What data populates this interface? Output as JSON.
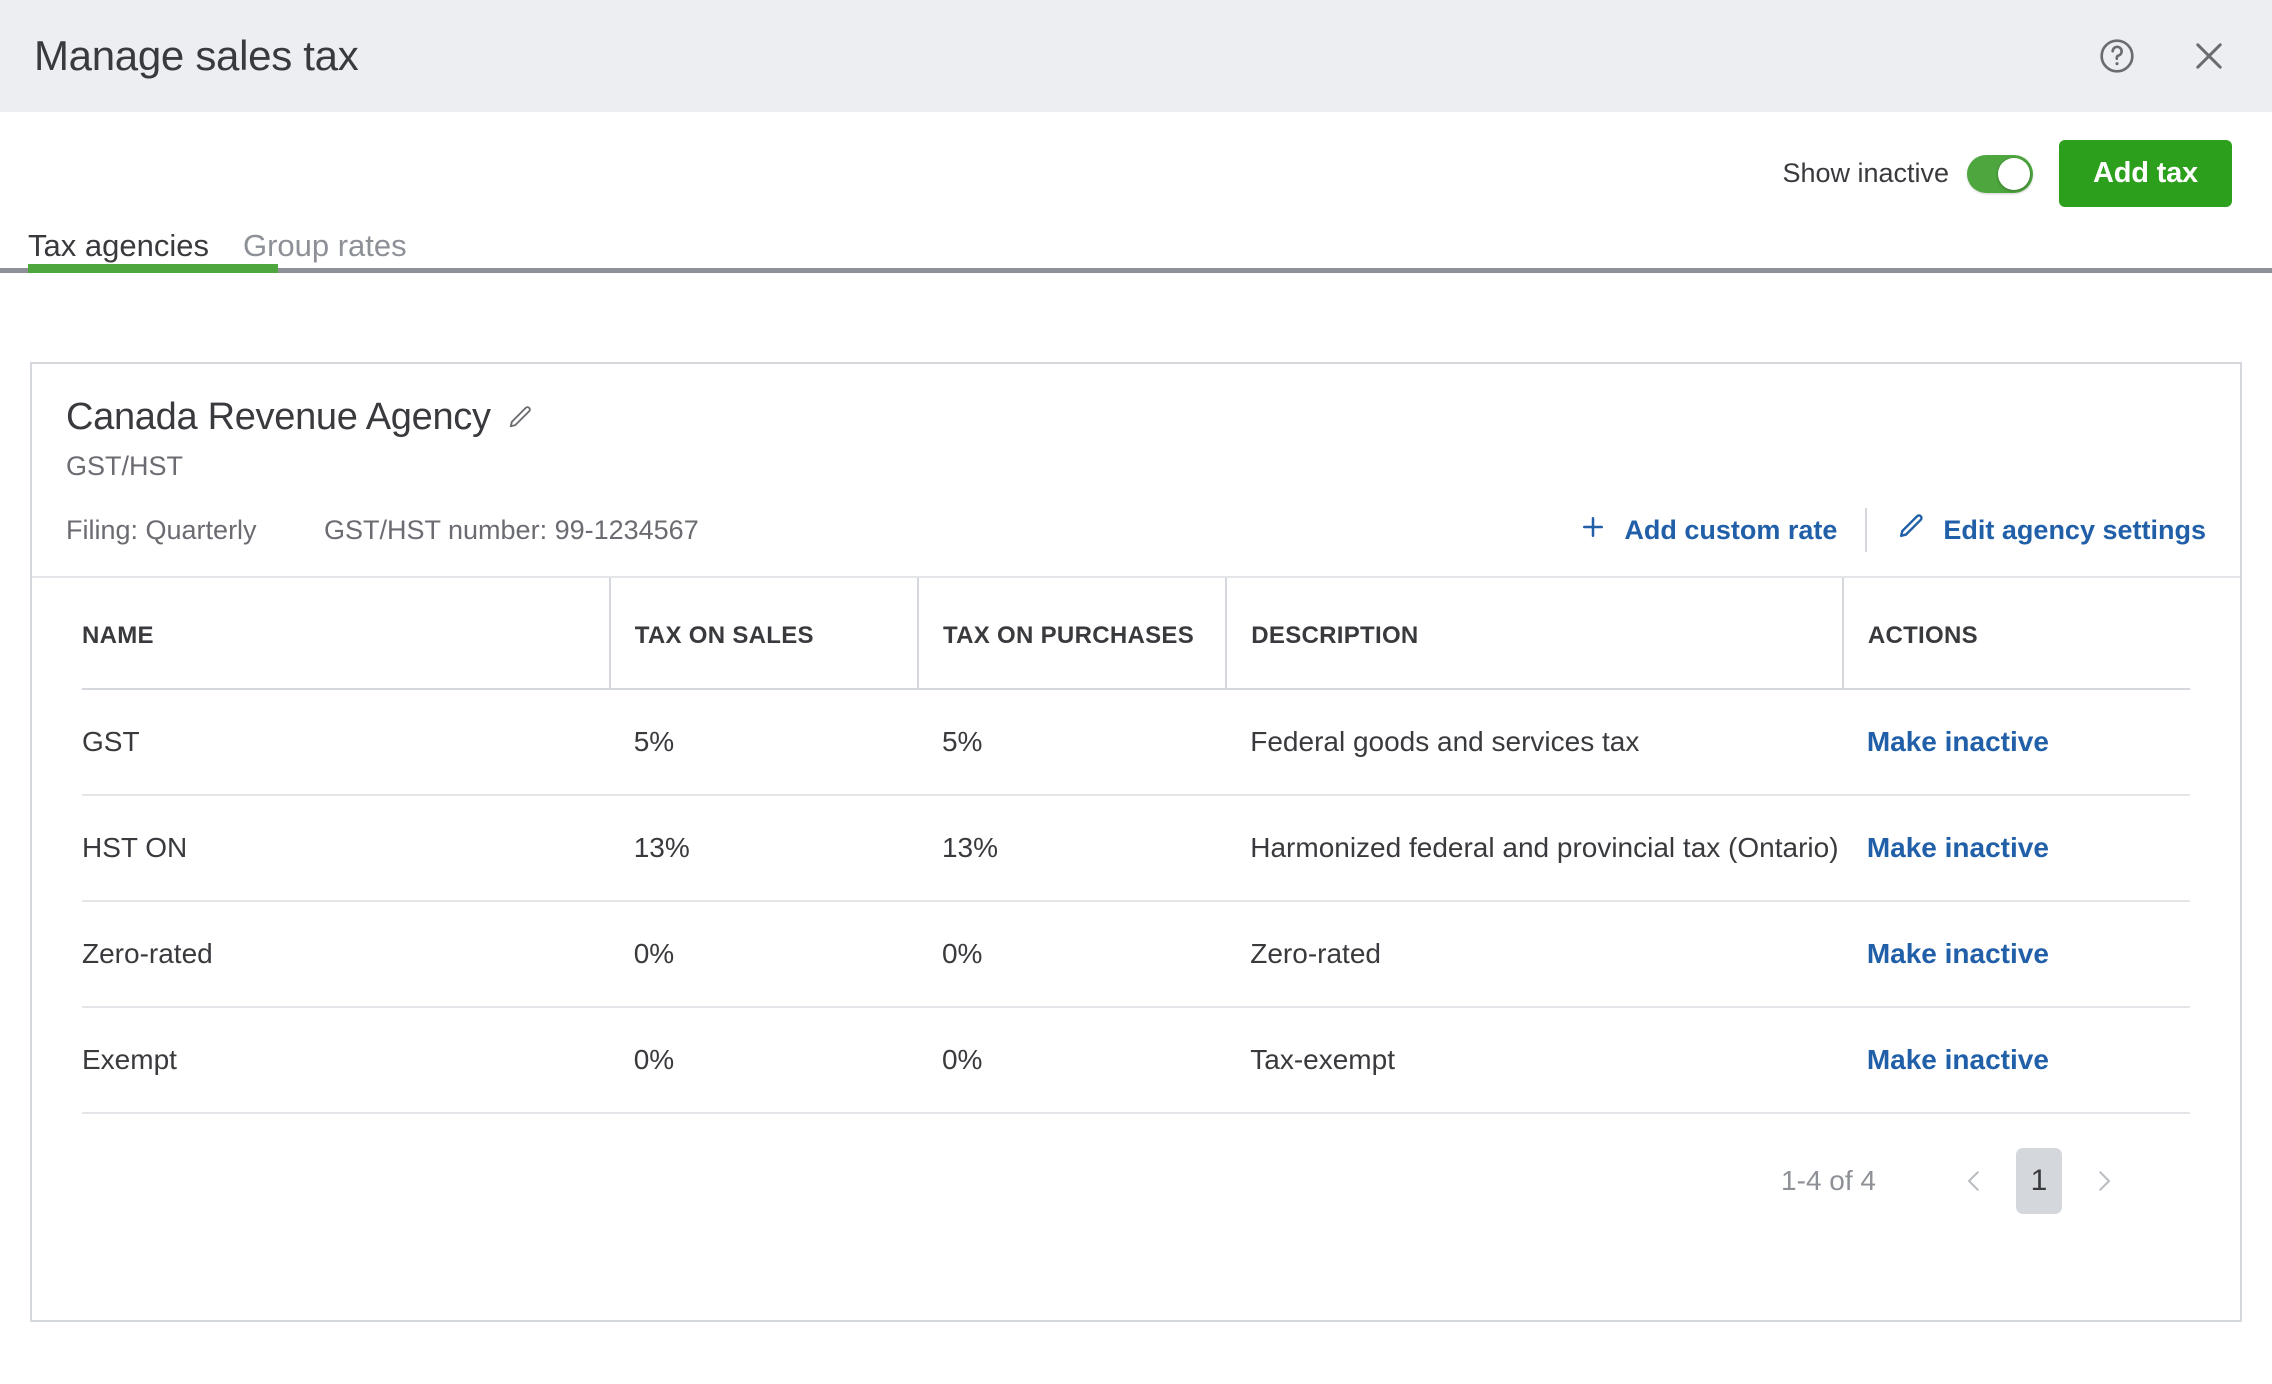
{
  "header": {
    "title": "Manage sales tax",
    "help_icon": "help-circle-icon",
    "close_icon": "close-icon"
  },
  "toolbar": {
    "show_inactive_label": "Show inactive",
    "show_inactive_on": true,
    "add_tax_label": "Add tax",
    "accent_green": "#2ca01c",
    "toggle_green": "#4ea63f"
  },
  "tabs": [
    {
      "label": "Tax agencies",
      "active": true
    },
    {
      "label": "Group rates",
      "active": false
    }
  ],
  "agency": {
    "name": "Canada Revenue Agency",
    "edit_icon": "pencil-icon",
    "tax_type": "GST/HST",
    "filing": "Filing: Quarterly",
    "tax_number": "GST/HST number: 99-1234567",
    "add_custom_rate_label": "Add custom rate",
    "add_custom_rate_icon": "plus-icon",
    "edit_settings_label": "Edit agency settings",
    "edit_settings_icon": "pencil-icon",
    "link_blue": "#2160a8"
  },
  "table": {
    "columns": [
      "NAME",
      "TAX ON SALES",
      "TAX ON PURCHASES",
      "DESCRIPTION",
      "ACTIONS"
    ],
    "rows": [
      {
        "name": "GST",
        "tax_on_sales": "5%",
        "tax_on_purchases": "5%",
        "description": "Federal goods and services tax",
        "action": "Make inactive"
      },
      {
        "name": "HST ON",
        "tax_on_sales": "13%",
        "tax_on_purchases": "13%",
        "description": "Harmonized federal and provincial tax (Ontario)",
        "action": "Make inactive"
      },
      {
        "name": "Zero-rated",
        "tax_on_sales": "0%",
        "tax_on_purchases": "0%",
        "description": "Zero-rated",
        "action": "Make inactive"
      },
      {
        "name": "Exempt",
        "tax_on_sales": "0%",
        "tax_on_purchases": "0%",
        "description": "Tax-exempt",
        "action": "Make inactive"
      }
    ]
  },
  "pagination": {
    "range_label": "1-4 of 4",
    "prev_icon": "chevron-left-icon",
    "next_icon": "chevron-right-icon",
    "current_page": "1"
  }
}
